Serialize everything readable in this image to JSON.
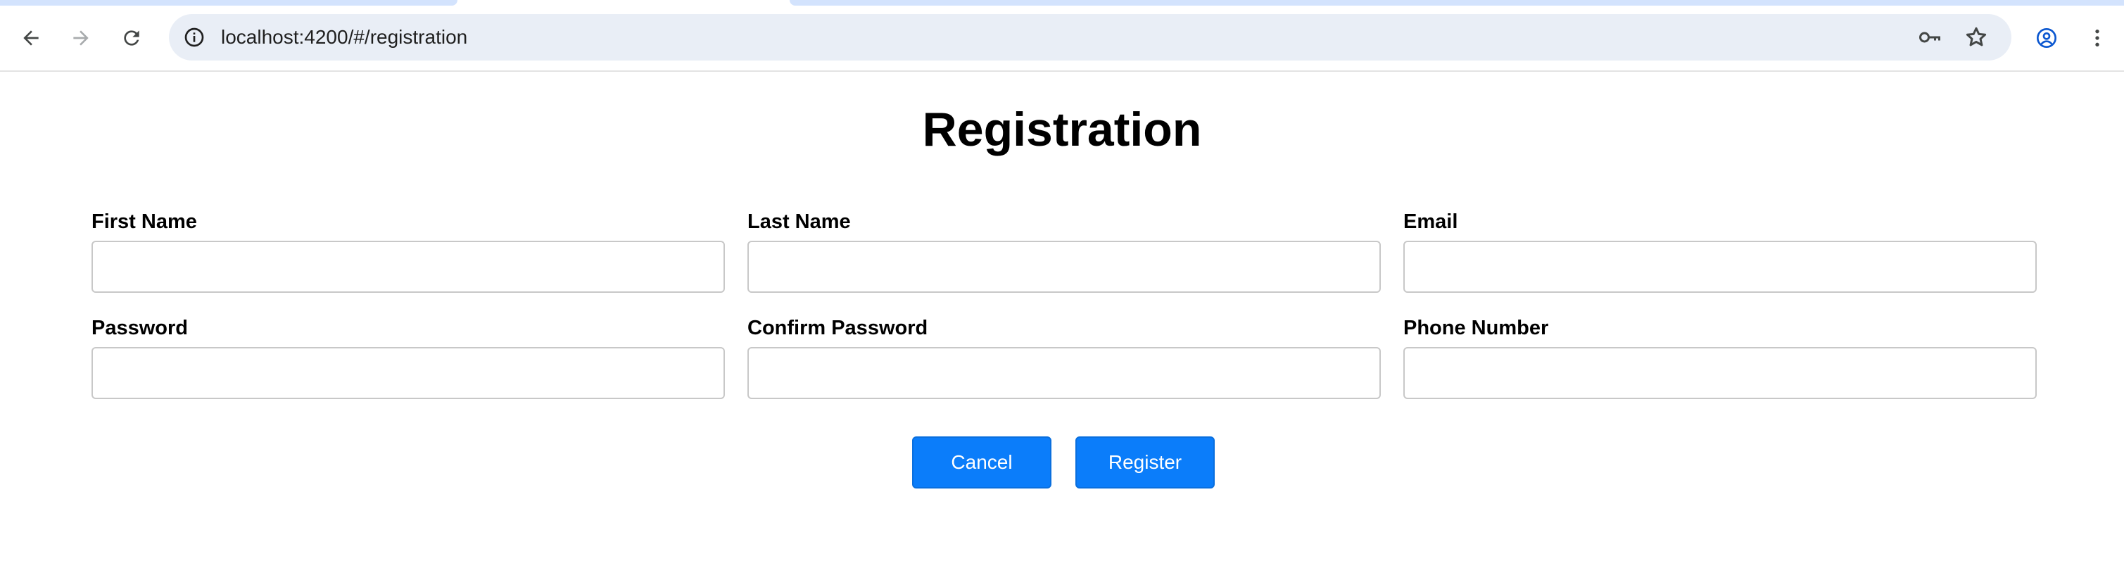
{
  "browser": {
    "url": "localhost:4200/#/registration",
    "icons": [
      "back-arrow-icon",
      "forward-arrow-icon",
      "reload-icon",
      "info-icon",
      "password-key-icon",
      "bookmark-star-icon",
      "profile-icon",
      "kebab-menu-icon"
    ],
    "accent": "#d3e3fd",
    "omnibox_bg": "#e9eef6"
  },
  "page": {
    "title": "Registration"
  },
  "form": {
    "first_name": {
      "label": "First Name",
      "value": "",
      "placeholder": ""
    },
    "last_name": {
      "label": "Last Name",
      "value": "",
      "placeholder": ""
    },
    "email": {
      "label": "Email",
      "value": "",
      "placeholder": ""
    },
    "password": {
      "label": "Password",
      "value": "",
      "placeholder": ""
    },
    "confirm_password": {
      "label": "Confirm Password",
      "value": "",
      "placeholder": ""
    },
    "phone_number": {
      "label": "Phone Number",
      "value": "",
      "placeholder": ""
    }
  },
  "actions": {
    "cancel_label": "Cancel",
    "register_label": "Register",
    "button_color": "#0b7dfa"
  }
}
